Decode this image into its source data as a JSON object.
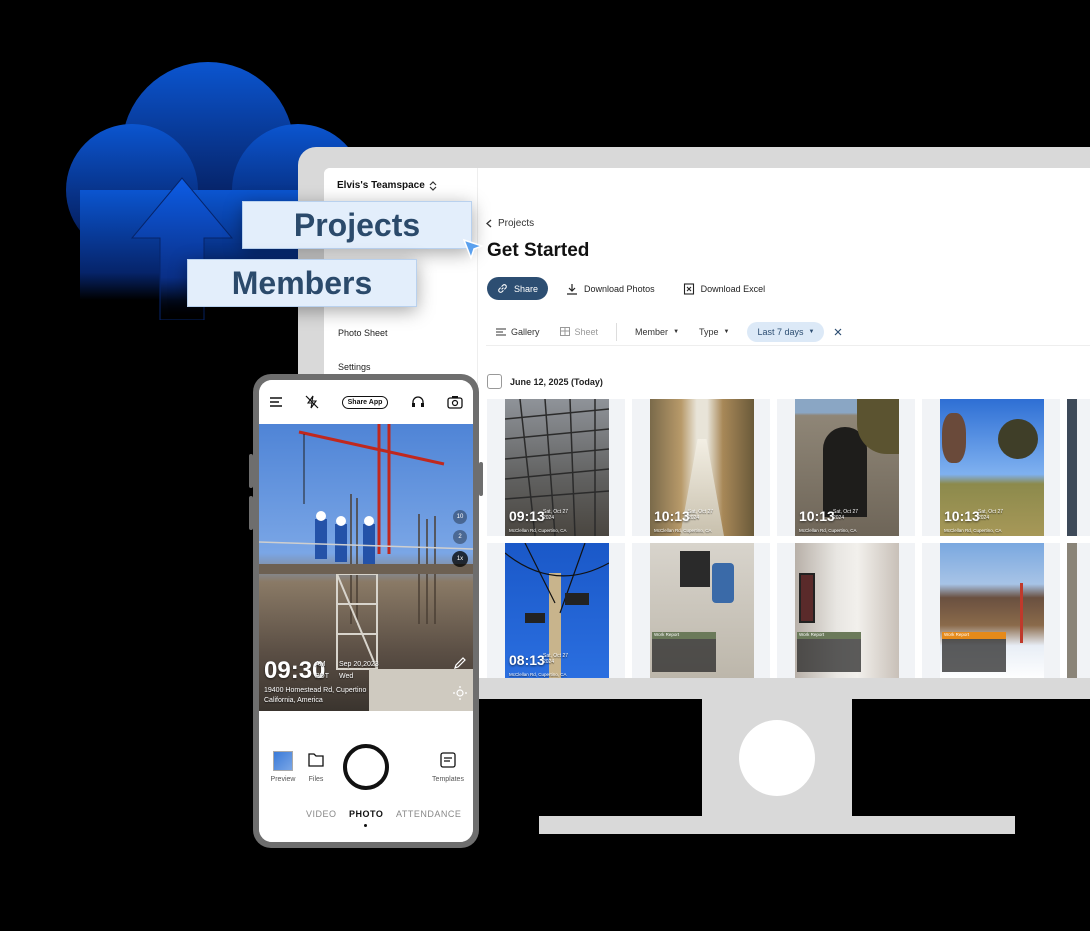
{
  "labels": {
    "projects": "Projects",
    "members": "Members"
  },
  "desktop": {
    "workspace": "Elvis's Teamspace",
    "sidebar": {
      "items": [
        "Photo Sheet",
        "Settings"
      ]
    },
    "breadcrumb": "Projects",
    "page_title": "Get Started",
    "actions": {
      "share": "Share",
      "download_photos": "Download Photos",
      "download_excel": "Download Excel"
    },
    "filters": {
      "gallery": "Gallery",
      "sheet": "Sheet",
      "member": "Member",
      "type": "Type",
      "date_range": "Last 7 days"
    },
    "date_group": "June 12, 2025 (Today)",
    "photos": [
      {
        "time": "09:13",
        "date": "Sat, Oct 27",
        "year": "2024",
        "address": "McClellan Rd, Cupertino, CA"
      },
      {
        "time": "10:13",
        "date": "Sat, Oct 27",
        "year": "2024",
        "address": "McClellan Rd, Cupertino, CA"
      },
      {
        "time": "10:13",
        "date": "Sat, Oct 27",
        "year": "2024",
        "address": "McClellan Rd, Cupertino, CA"
      },
      {
        "time": "10:13",
        "date": "Sat, Oct 27",
        "year": "2024",
        "address": "McClellan Rd, Cupertino, CA"
      },
      {
        "time": "08:13",
        "date": "Sat, Oct 27",
        "year": "2024",
        "address": "McClellan Rd, Cupertino, CA"
      },
      {
        "report": "Work Report"
      },
      {
        "report": "Work Report"
      },
      {
        "report": "Work Report"
      }
    ]
  },
  "phone": {
    "share_app": "Share App",
    "zoom_levels": [
      "10",
      "2",
      "1x"
    ],
    "time": "09:30",
    "ampm": "AM",
    "tz": "PDT",
    "date": "Sep 20,2023",
    "weekday": "Wed",
    "address_line1": "19400 Homestead Rd, Cupertino",
    "address_line2": "California, America",
    "bottom": {
      "preview": "Preview",
      "files": "Files",
      "templates": "Templates"
    },
    "modes": [
      "VIDEO",
      "PHOTO",
      "ATTENDANCE"
    ]
  },
  "colors": {
    "primary": "#2d4e72",
    "accent_bg": "#dce9f7",
    "cloud": "#0a4bb8"
  }
}
